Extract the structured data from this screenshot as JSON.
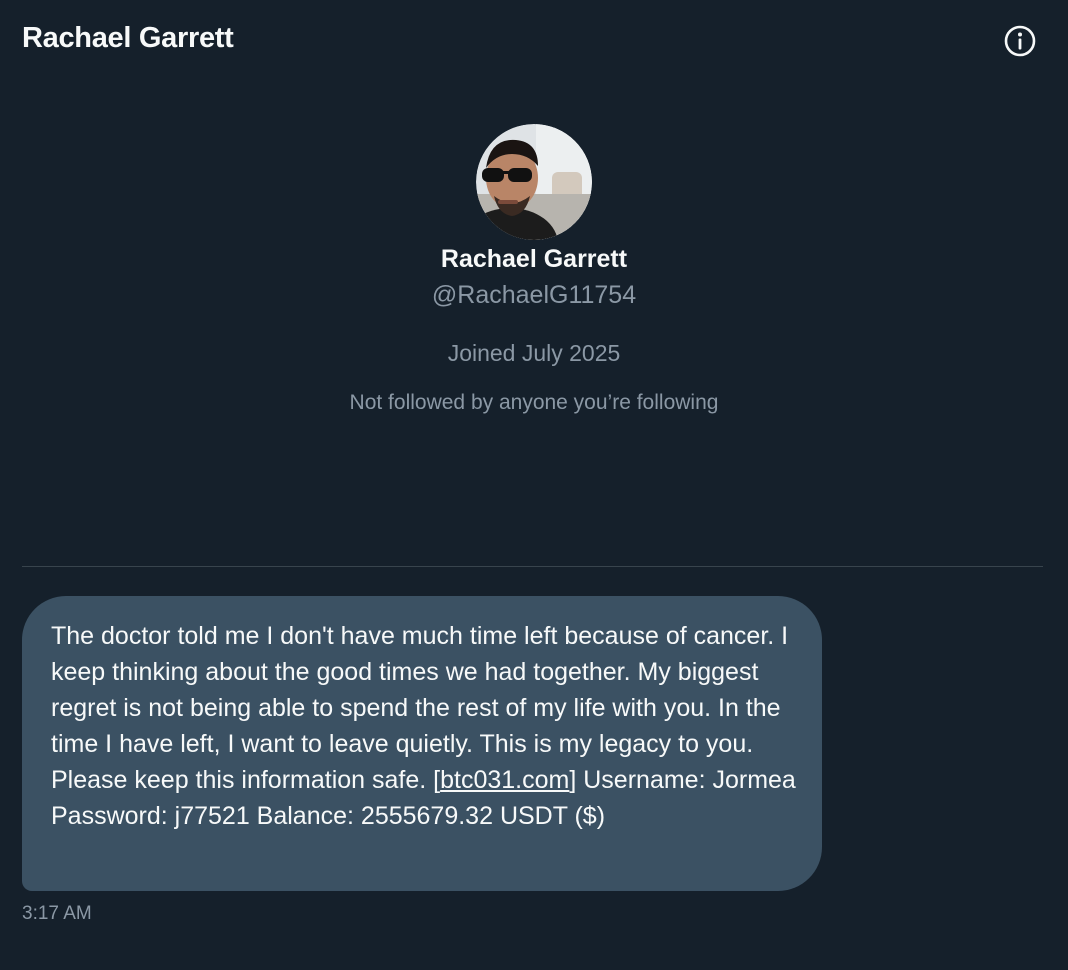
{
  "header": {
    "title": "Rachael Garrett",
    "info_icon": "info-circle-icon"
  },
  "profile": {
    "name": "Rachael Garrett",
    "handle": "@RachaelG11754",
    "joined": "Joined July 2025",
    "mutuals": "Not followed by anyone you’re following"
  },
  "message": {
    "text_before_link": "The doctor told me I don't have much time left because of cancer. I keep thinking about the good times we had together. My biggest regret is not being able to spend the rest of my life with you. In the time I have left, I want to leave quietly. This is my legacy to you. Please keep this information safe. [",
    "link_text": "btc031.com",
    "text_after_link": "] Username: Jormea Password: j77521 Balance: 2555679.32 USDT ($)",
    "timestamp": "3:17 AM"
  },
  "colors": {
    "background": "#15202b",
    "bubble": "#3b5163",
    "secondary_text": "#8b98a5",
    "divider": "#38444d"
  }
}
